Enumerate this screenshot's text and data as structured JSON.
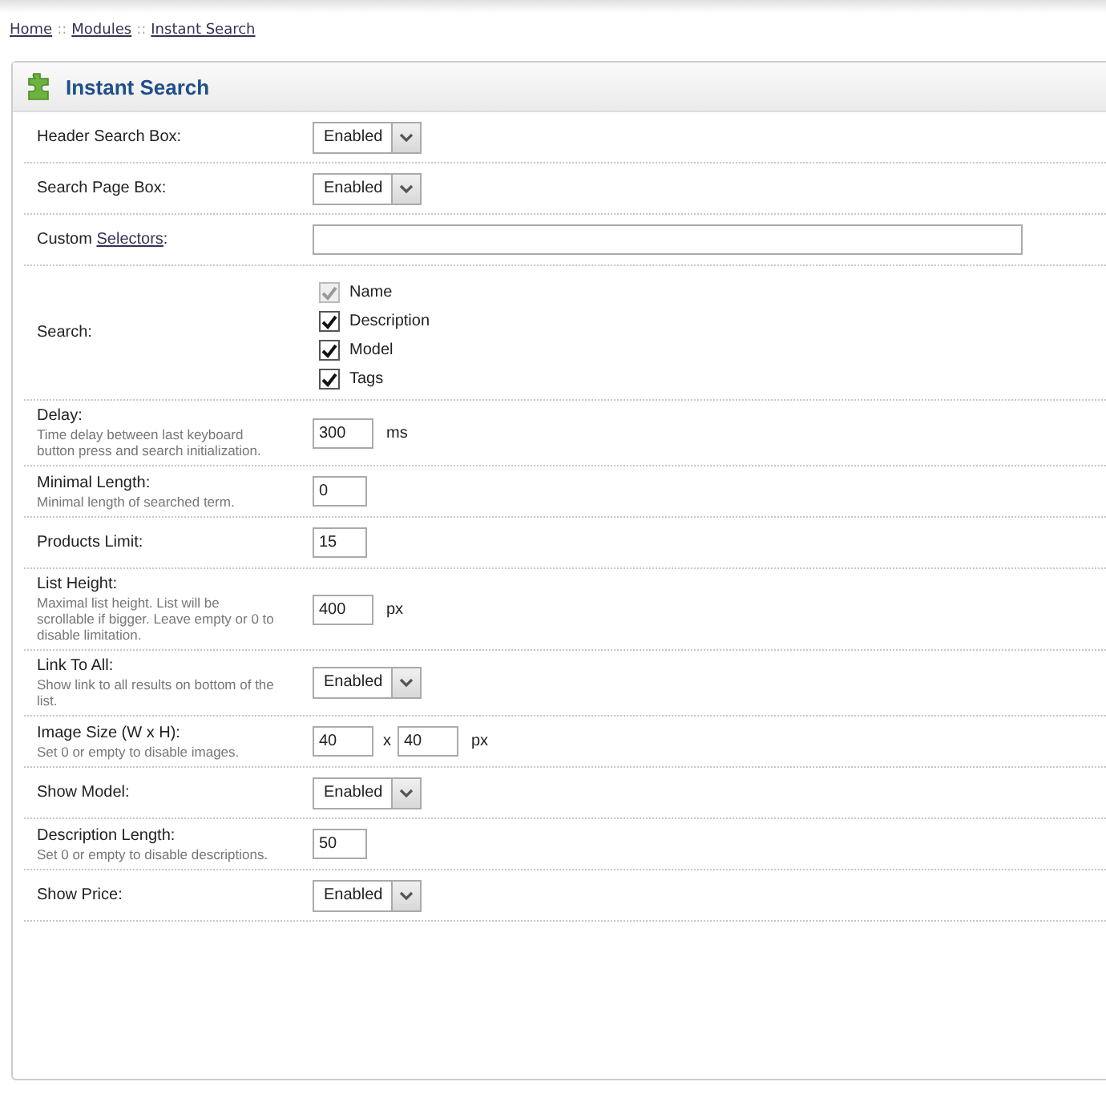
{
  "breadcrumb": [
    {
      "label": "Home"
    },
    {
      "label": "Modules"
    },
    {
      "label": "Instant Search"
    }
  ],
  "breadcrumb_separator": "::",
  "panel": {
    "title": "Instant Search"
  },
  "rows": [
    {
      "kind": "select",
      "label": "Header Search Box:",
      "value": "Enabled"
    },
    {
      "kind": "select",
      "label": "Search Page Box:",
      "value": "Enabled"
    },
    {
      "kind": "wide",
      "label": "Custom ",
      "label_link": "Selectors",
      "label_after": ":"
    },
    {
      "kind": "checks",
      "label": "Search:",
      "options": [
        {
          "label": "Name",
          "checked": true,
          "disabled": true
        },
        {
          "label": "Description",
          "checked": true,
          "disabled": false
        },
        {
          "label": "Model",
          "checked": true,
          "disabled": false
        },
        {
          "label": "Tags",
          "checked": true,
          "disabled": false
        }
      ]
    },
    {
      "kind": "number",
      "label": "Delay:",
      "hint": "Time delay between last keyboard button press and search initialization.",
      "value": "300",
      "unit": "ms"
    },
    {
      "kind": "number",
      "label": "Minimal Length:",
      "hint": "Minimal length of searched term.",
      "value": "0"
    },
    {
      "kind": "number",
      "label": "Products Limit:",
      "value": "15"
    },
    {
      "kind": "number",
      "label": "List Height:",
      "hint": "Maximal list height. List will be scrollable if bigger. Leave empty or 0 to disable limitation.",
      "value": "400",
      "unit": "px"
    },
    {
      "kind": "select",
      "label": "Link To All:",
      "hint": "Show link to all results on bottom of the list.",
      "value": "Enabled"
    },
    {
      "kind": "size",
      "label": "Image Size (W x H):",
      "hint": "Set 0 or empty to disable images.",
      "value": "40",
      "times": "x",
      "value2": "40",
      "unit": "px"
    },
    {
      "kind": "select",
      "label": "Show Model:",
      "value": "Enabled"
    },
    {
      "kind": "number",
      "label": "Description Length:",
      "hint": "Set 0 or empty to disable descriptions.",
      "value": "50"
    },
    {
      "kind": "select",
      "label": "Show Price:",
      "value": "Enabled"
    }
  ]
}
